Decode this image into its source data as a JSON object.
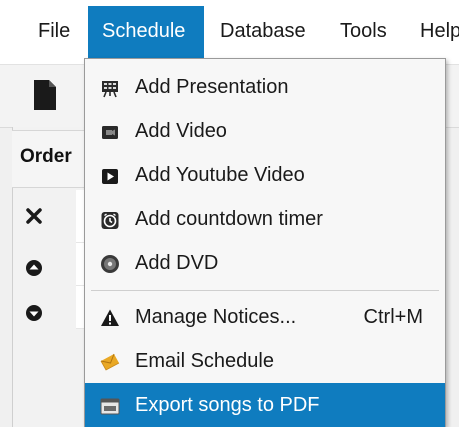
{
  "menubar": {
    "items": [
      {
        "label": "File"
      },
      {
        "label": "Schedule"
      },
      {
        "label": "Database"
      },
      {
        "label": "Tools"
      },
      {
        "label": "Help"
      }
    ],
    "active_index": 1
  },
  "sidebar": {
    "header": "Order",
    "icons": [
      "close-icon",
      "move-up-icon",
      "move-down-icon"
    ]
  },
  "schedule_menu": {
    "items": [
      {
        "label": "Add Presentation",
        "icon": "presentation-icon"
      },
      {
        "label": "Add Video",
        "icon": "video-icon"
      },
      {
        "label": "Add Youtube Video",
        "icon": "youtube-icon"
      },
      {
        "label": "Add countdown timer",
        "icon": "timer-icon"
      },
      {
        "label": "Add DVD",
        "icon": "dvd-icon"
      },
      {
        "label": "Manage Notices...",
        "icon": "warning-icon",
        "shortcut": "Ctrl+M"
      },
      {
        "label": "Email Schedule",
        "icon": "email-icon"
      },
      {
        "label": "Export songs to PDF",
        "icon": "pdf-export-icon",
        "highlighted": true
      }
    ]
  },
  "colors": {
    "accent": "#0f7cbf",
    "menu_bg": "#f7f7f7"
  }
}
